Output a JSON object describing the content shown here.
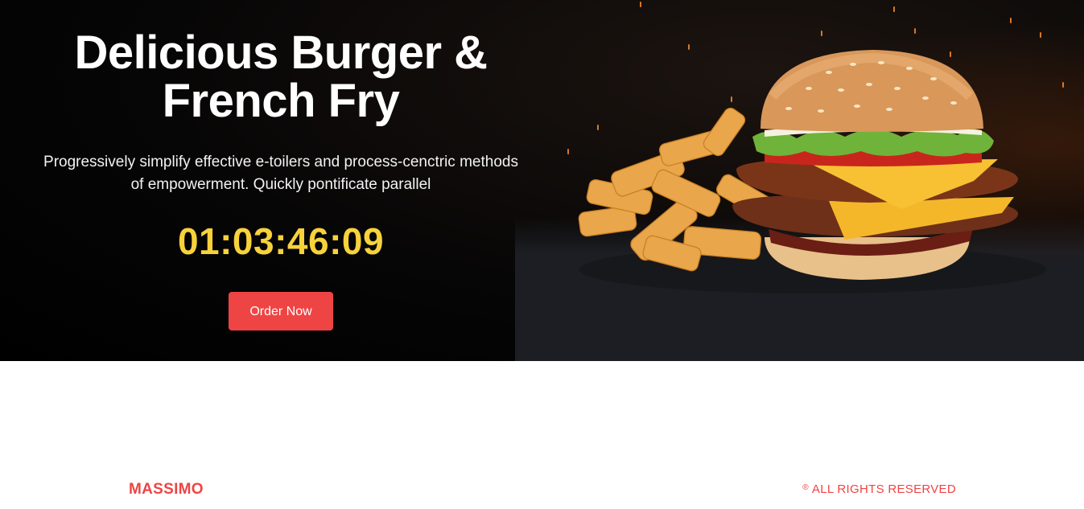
{
  "hero": {
    "title": "Delicious Burger & French Fry",
    "description": "Progressively simplify effective e-toilers and process-cenctric methods of empowerment. Quickly pontificate parallel",
    "countdown": "01:03:46:09",
    "cta_label": "Order Now",
    "image_alt": "burger-and-fries"
  },
  "footer": {
    "brand": "MASSIMO",
    "rights_symbol": "®",
    "rights_text": "ALL RIGHTS RESERVED"
  },
  "colors": {
    "accent": "#ef4444",
    "countdown": "#f7d23a",
    "hero_bg": "#000000",
    "page_bg": "#ffffff"
  }
}
